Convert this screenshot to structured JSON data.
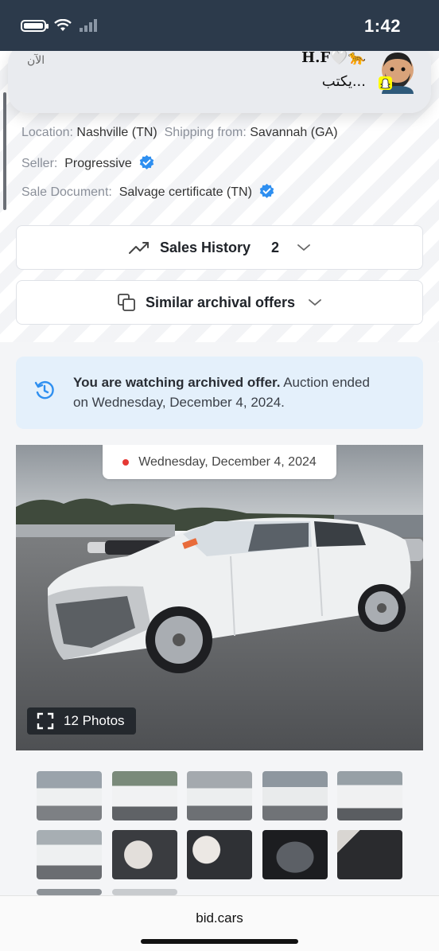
{
  "status_bar": {
    "time": "1:42"
  },
  "notification": {
    "when": "الآن",
    "sender": "H.F🤍🐆",
    "message": "يكتب..."
  },
  "listing": {
    "location_label": "Location:",
    "location_value": "Nashville (TN)",
    "shipping_label": "Shipping from:",
    "shipping_value": "Savannah (GA)",
    "seller_label": "Seller:",
    "seller_value": "Progressive",
    "sale_doc_label": "Sale Document:",
    "sale_doc_value": "Salvage certificate (TN)"
  },
  "sales_history": {
    "label": "Sales History",
    "count": "2"
  },
  "similar": {
    "label": "Similar archival offers"
  },
  "archive_banner": {
    "bold": "You are watching archived offer.",
    "rest": " Auction ended on Wednesday, December 4, 2024."
  },
  "photo": {
    "date": "Wednesday, December 4, 2024",
    "photos_label": "12 Photos"
  },
  "thumbnails": [
    "front-left view",
    "left side view",
    "left rear view",
    "front-left view far",
    "front view",
    "rear view",
    "airbag interior",
    "deployed airbags",
    "instrument cluster",
    "rear seats",
    "partial thumb 1",
    "partial thumb 2"
  ],
  "browser": {
    "url": "bid.cars"
  },
  "colors": {
    "accent_blue": "#2e8ff0",
    "banner_bg": "#e4f0fb",
    "status_bar": "#2c3a4b"
  }
}
